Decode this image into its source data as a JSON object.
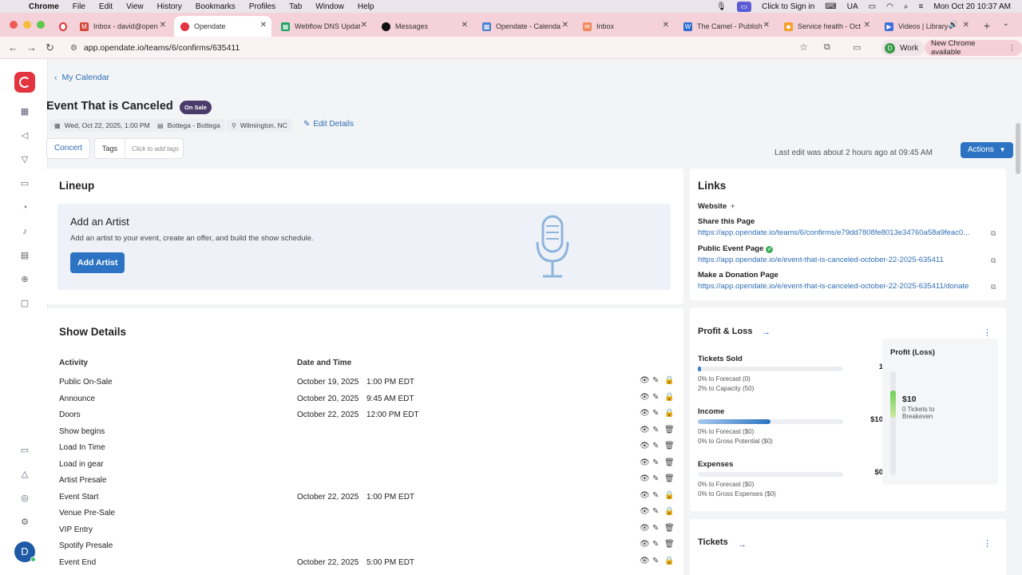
{
  "menubar": {
    "app": "Chrome",
    "items": [
      "File",
      "Edit",
      "View",
      "History",
      "Bookmarks",
      "Profiles",
      "Tab",
      "Window",
      "Help"
    ],
    "sign_in": "Click to Sign in",
    "input_source": "UA",
    "datetime": "Mon Oct 20  10:37 AM"
  },
  "tabs": [
    {
      "label": "Inbox - david@open",
      "active": false
    },
    {
      "label": "Opendate",
      "active": true
    },
    {
      "label": "Webflow DNS Updat",
      "active": false
    },
    {
      "label": "Messages",
      "active": false
    },
    {
      "label": "Opendate - Calenda",
      "active": false
    },
    {
      "label": "Inbox",
      "active": false
    },
    {
      "label": "The Camel - Publish",
      "active": false
    },
    {
      "label": "Service health - Oct",
      "active": false
    },
    {
      "label": "Videos | Library",
      "active": false
    }
  ],
  "address": {
    "url": "app.opendate.io/teams/6/confirms/635411",
    "profile": "Work",
    "profile_initial": "D",
    "new_chrome": "New Chrome available"
  },
  "sidebar": {
    "avatar_initial": "D"
  },
  "breadcrumb": "My Calendar",
  "event": {
    "title": "Event That is Canceled",
    "status": "On Sale",
    "date": "Wed, Oct 22, 2025, 1:00 PM",
    "venue": "Bottega - Bottega",
    "location": "Wilmington, NC",
    "edit_details": "Edit Details",
    "type": "Concert",
    "tags_label": "Tags",
    "tags_placeholder": "Click to add tags",
    "last_edit": "Last edit was about 2 hours ago at 09:45 AM",
    "actions": "Actions"
  },
  "lineup": {
    "heading": "Lineup",
    "add_title": "Add an Artist",
    "add_desc": "Add an artist to your event, create an offer, and build the show schedule.",
    "add_button": "Add Artist"
  },
  "show_details": {
    "heading": "Show Details",
    "col_activity": "Activity",
    "col_datetime": "Date and Time",
    "rows": [
      {
        "activity": "Public On-Sale",
        "date": "October 19, 2025",
        "time": "1:00 PM EDT",
        "locked": true
      },
      {
        "activity": "Announce",
        "date": "October 20, 2025",
        "time": "9:45 AM EDT",
        "locked": true
      },
      {
        "activity": "Doors",
        "date": "October 22, 2025",
        "time": "12:00 PM EDT",
        "locked": true
      },
      {
        "activity": "Show begins",
        "date": "",
        "time": "",
        "locked": false
      },
      {
        "activity": "Load In Time",
        "date": "",
        "time": "",
        "locked": false
      },
      {
        "activity": "Load in gear",
        "date": "",
        "time": "",
        "locked": false
      },
      {
        "activity": "Artist Presale",
        "date": "",
        "time": "",
        "locked": false
      },
      {
        "activity": "Event Start",
        "date": "October 22, 2025",
        "time": "1:00 PM EDT",
        "locked": true
      },
      {
        "activity": "Venue Pre-Sale",
        "date": "",
        "time": "",
        "locked": true
      },
      {
        "activity": "VIP Entry",
        "date": "",
        "time": "",
        "locked": false
      },
      {
        "activity": "Spotify Presale",
        "date": "",
        "time": "",
        "locked": false
      },
      {
        "activity": "Event End",
        "date": "October 22, 2025",
        "time": "5:00 PM EDT",
        "locked": true
      }
    ]
  },
  "links": {
    "heading": "Links",
    "website": "Website",
    "share_label": "Share this Page",
    "share_url": "https://app.opendate.io/teams/6/confirms/e79dd7808fe8013e34760a58a9feac0...",
    "public_label": "Public Event Page",
    "public_url": "https://app.opendate.io/e/event-that-is-canceled-october-22-2025-635411",
    "donation_label": "Make a Donation Page",
    "donation_url": "https://app.opendate.io/e/event-that-is-canceled-october-22-2025-635411/donate"
  },
  "profit_loss": {
    "heading": "Profit & Loss",
    "tickets_sold": {
      "label": "Tickets Sold",
      "value": "1",
      "fill": 0.02,
      "line1": "0% to Forecast (0)",
      "line2": "2% to Capacity (50)"
    },
    "income": {
      "label": "Income",
      "value": "$10",
      "fill": 0.5,
      "line1": "0% to Forecast ($0)",
      "line2": "0% to Gross Potential ($0)"
    },
    "expenses": {
      "label": "Expenses",
      "value": "$0",
      "fill": 0,
      "line1": "0% to Forecast ($0)",
      "line2": "0% to Gross Expenses ($0)"
    },
    "panel_title": "Profit (Loss)",
    "panel_value": "$10",
    "panel_sub": "0 Tickets to Breakeven"
  },
  "tickets": {
    "heading": "Tickets"
  }
}
